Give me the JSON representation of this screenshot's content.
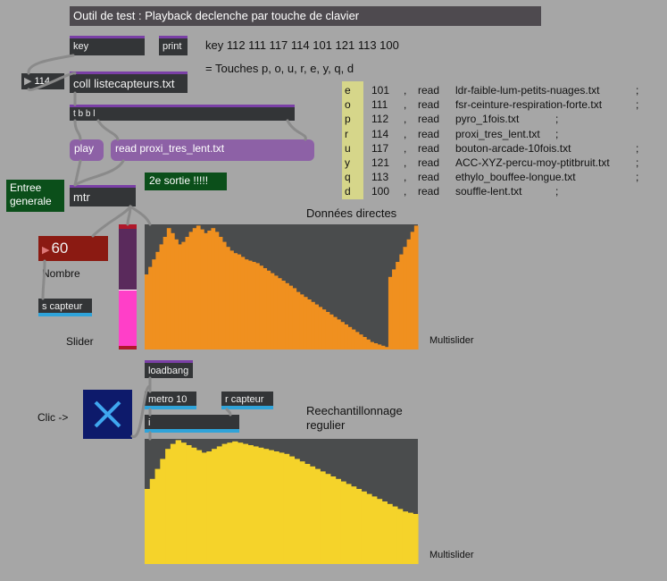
{
  "title": "Outil de test : Playback declenche par touche de clavier",
  "objects": {
    "key": "key",
    "print": "print",
    "number_114": "114",
    "coll": "coll listecapteurs.txt",
    "tbbl": "t b b l",
    "play": "play",
    "read_msg": "read proxi_tres_lent.txt",
    "mtr": "mtr",
    "second_output": "2e sortie !!!!!",
    "entree": "Entree generale",
    "number_60": "60",
    "s_capteur": "s capteur",
    "loadbang": "loadbang",
    "metro": "metro 10",
    "r_capteur": "r capteur",
    "i": "i"
  },
  "comments": {
    "key_codes": "key 112 111 117 114 101 121 113 100",
    "touches": "= Touches p, o, u, r, e, y, q, d",
    "donnees": "Données directes",
    "nombre": "Nombre",
    "slider": "Slider",
    "multislider1": "Multislider",
    "clic": "Clic ->",
    "reech": "Reechantillonnage regulier",
    "multislider2": "Multislider"
  },
  "mapping": [
    {
      "letter": "e",
      "code": "101",
      "sep": ",",
      "cmd": "read",
      "file": "ldr-faible-lum-petits-nuages.txt",
      "end": ";"
    },
    {
      "letter": "o",
      "code": "111",
      "sep": ",",
      "cmd": "read",
      "file": "fsr-ceinture-respiration-forte.txt",
      "end": ";"
    },
    {
      "letter": "p",
      "code": "112",
      "sep": ",",
      "cmd": "read",
      "file": "pyro_1fois.txt",
      "end": ";"
    },
    {
      "letter": "r",
      "code": "114",
      "sep": ",",
      "cmd": "read",
      "file": "proxi_tres_lent.txt",
      "end": ";"
    },
    {
      "letter": "u",
      "code": "117",
      "sep": ",",
      "cmd": "read",
      "file": "bouton-arcade-10fois.txt",
      "end": ";"
    },
    {
      "letter": "y",
      "code": "121",
      "sep": ",",
      "cmd": "read",
      "file": "ACC-XYZ-percu-moy-ptitbruit.txt",
      "end": ";"
    },
    {
      "letter": "q",
      "code": "113",
      "sep": ",",
      "cmd": "read",
      "file": "ethylo_bouffee-longue.txt",
      "end": ";"
    },
    {
      "letter": "d",
      "code": "100",
      "sep": ",",
      "cmd": "read",
      "file": "souffle-lent.txt",
      "end": ";"
    }
  ],
  "slider": {
    "value_fraction": 0.47,
    "color_fill": "#ff3fc8",
    "color_bg": "#5a2a5c"
  },
  "toggle": {
    "state": "on"
  },
  "colors": {
    "multislider1_fill": "#f0901f",
    "multislider2_fill": "#f5d32a",
    "multislider_bg": "#4a4c4d"
  },
  "multislider1_values": [
    0.6,
    0.66,
    0.72,
    0.78,
    0.84,
    0.9,
    0.97,
    0.93,
    0.88,
    0.84,
    0.86,
    0.9,
    0.94,
    0.97,
    0.99,
    0.96,
    0.93,
    0.95,
    0.97,
    0.94,
    0.9,
    0.86,
    0.82,
    0.79,
    0.77,
    0.76,
    0.74,
    0.72,
    0.71,
    0.7,
    0.69,
    0.67,
    0.65,
    0.63,
    0.61,
    0.59,
    0.57,
    0.55,
    0.53,
    0.51,
    0.49,
    0.46,
    0.44,
    0.42,
    0.4,
    0.38,
    0.36,
    0.34,
    0.32,
    0.3,
    0.28,
    0.26,
    0.24,
    0.22,
    0.2,
    0.18,
    0.16,
    0.14,
    0.12,
    0.1,
    0.08,
    0.06,
    0.05,
    0.04,
    0.03,
    0.02,
    0.58,
    0.64,
    0.7,
    0.76,
    0.82,
    0.88,
    0.94,
    0.99
  ],
  "multislider2_values": [
    0.6,
    0.68,
    0.76,
    0.84,
    0.92,
    0.96,
    0.99,
    0.97,
    0.95,
    0.93,
    0.91,
    0.89,
    0.9,
    0.92,
    0.94,
    0.96,
    0.97,
    0.98,
    0.97,
    0.96,
    0.95,
    0.94,
    0.93,
    0.92,
    0.91,
    0.9,
    0.89,
    0.88,
    0.86,
    0.84,
    0.82,
    0.8,
    0.78,
    0.76,
    0.74,
    0.72,
    0.7,
    0.68,
    0.66,
    0.64,
    0.62,
    0.6,
    0.58,
    0.56,
    0.54,
    0.52,
    0.5,
    0.48,
    0.46,
    0.44,
    0.42,
    0.41,
    0.4
  ]
}
